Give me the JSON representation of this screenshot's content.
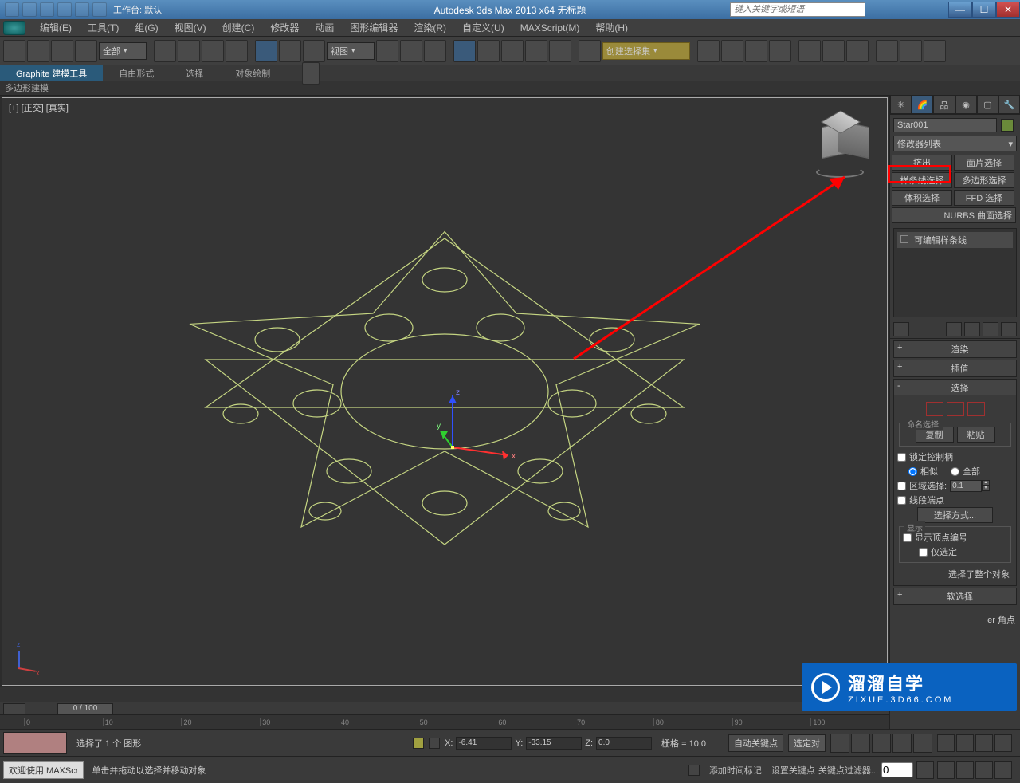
{
  "titlebar": {
    "workspace_label": "工作台: 默认",
    "title": "Autodesk 3ds Max  2013 x64    无标题",
    "search_placeholder": "键入关键字或短语"
  },
  "menubar": [
    "编辑(E)",
    "工具(T)",
    "组(G)",
    "视图(V)",
    "创建(C)",
    "修改器",
    "动画",
    "图形编辑器",
    "渲染(R)",
    "自定义(U)",
    "MAXScript(M)",
    "帮助(H)"
  ],
  "toolbar": {
    "filter_all": "全部",
    "view_label": "视图",
    "create_set": "创建选择集"
  },
  "ribbon": {
    "tabs": [
      "Graphite 建模工具",
      "自由形式",
      "选择",
      "对象绘制"
    ],
    "sub": "多边形建模"
  },
  "viewport": {
    "label": "[+] [正交] [真实]"
  },
  "cmdpanel": {
    "object_name": "Star001",
    "modifier_list_label": "修改器列表",
    "buttons": {
      "extrude": "挤出",
      "face_select": "面片选择",
      "spline_select": "样条线选择",
      "poly_select": "多边形选择",
      "vol_select": "体积选择",
      "ffd_select": "FFD 选择",
      "nurbs": "NURBS 曲面选择"
    },
    "stack_item": "可编辑样条线",
    "rollouts": {
      "render": "渲染",
      "interp": "插值",
      "select": "选择",
      "soft": "软选择"
    },
    "select_section": {
      "named_sel": "命名选择:",
      "copy": "复制",
      "paste": "粘贴",
      "lock_handles": "锁定控制柄",
      "similar": "相似",
      "all": "全部",
      "area_select": "区域选择:",
      "area_value": "0.1",
      "segment_end": "线段端点",
      "select_by": "选择方式...",
      "display": "显示",
      "show_vert_num": "显示顶点编号",
      "only_sel": "仅选定",
      "selected_info": "选择了整个对象"
    }
  },
  "timeslider": {
    "thumb": "0 / 100"
  },
  "status": {
    "line1": "选择了 1 个 图形",
    "line2": "单击并拖动以选择并移动对象",
    "x_label": "X:",
    "x_val": "-6.41",
    "y_label": "Y:",
    "y_val": "-33.15",
    "z_label": "Z:",
    "z_val": "0.0",
    "grid": "栅格 = 10.0",
    "add_time_tag": "添加时间标记",
    "auto_key": "自动关键点",
    "set_key": "设置关键点",
    "selected_combo": "选定对",
    "key_filter": "关键点过滤器...",
    "bezier": "er 角点"
  },
  "welcome": {
    "label": "欢迎使用  MAXScr"
  },
  "watermark": {
    "main": "溜溜自学",
    "sub": "ZIXUE.3D66.COM"
  }
}
